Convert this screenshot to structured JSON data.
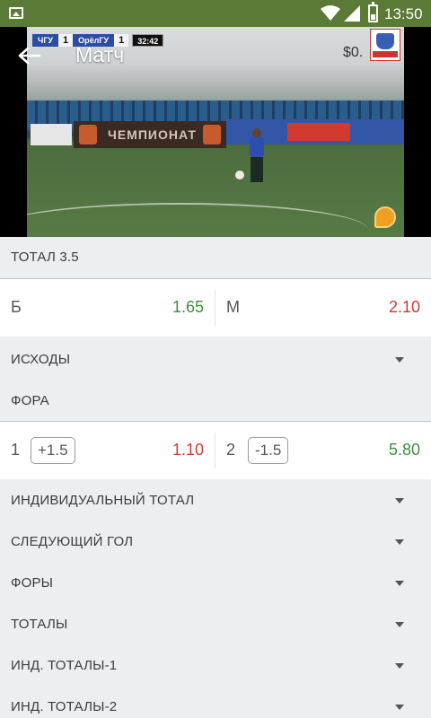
{
  "status_bar": {
    "time": "13:50"
  },
  "header": {
    "title": "Матч",
    "overlay_text": "$0."
  },
  "video": {
    "score": {
      "home_team": "ЧГУ",
      "home_score": "1",
      "away_team": "ОрёлГУ",
      "away_score": "1",
      "match_clock": "32:42"
    },
    "banner_text": "ЧЕМПИОНАТ"
  },
  "total": {
    "title": "ТОТАЛ 3.5",
    "over_label": "Б",
    "over_odds": "1.65",
    "under_label": "М",
    "under_odds": "2.10"
  },
  "outcomes": {
    "label": "ИСХОДЫ"
  },
  "handicap": {
    "title": "ФОРА",
    "left_label": "1",
    "left_value": "+1.5",
    "left_odds": "1.10",
    "right_label": "2",
    "right_value": "-1.5",
    "right_odds": "5.80"
  },
  "markets": [
    "ИНДИВИДУАЛЬНЫЙ ТОТАЛ",
    "СЛЕДУЮЩИЙ ГОЛ",
    "ФОРЫ",
    "ТОТАЛЫ",
    "ИНД. ТОТАЛЫ-1",
    "ИНД. ТОТАЛЫ-2"
  ],
  "colors": {
    "status_bar": "#5a7a35",
    "odds_up": "#3d8f3f",
    "odds_down": "#cf3b3b",
    "background": "#eceff0"
  }
}
